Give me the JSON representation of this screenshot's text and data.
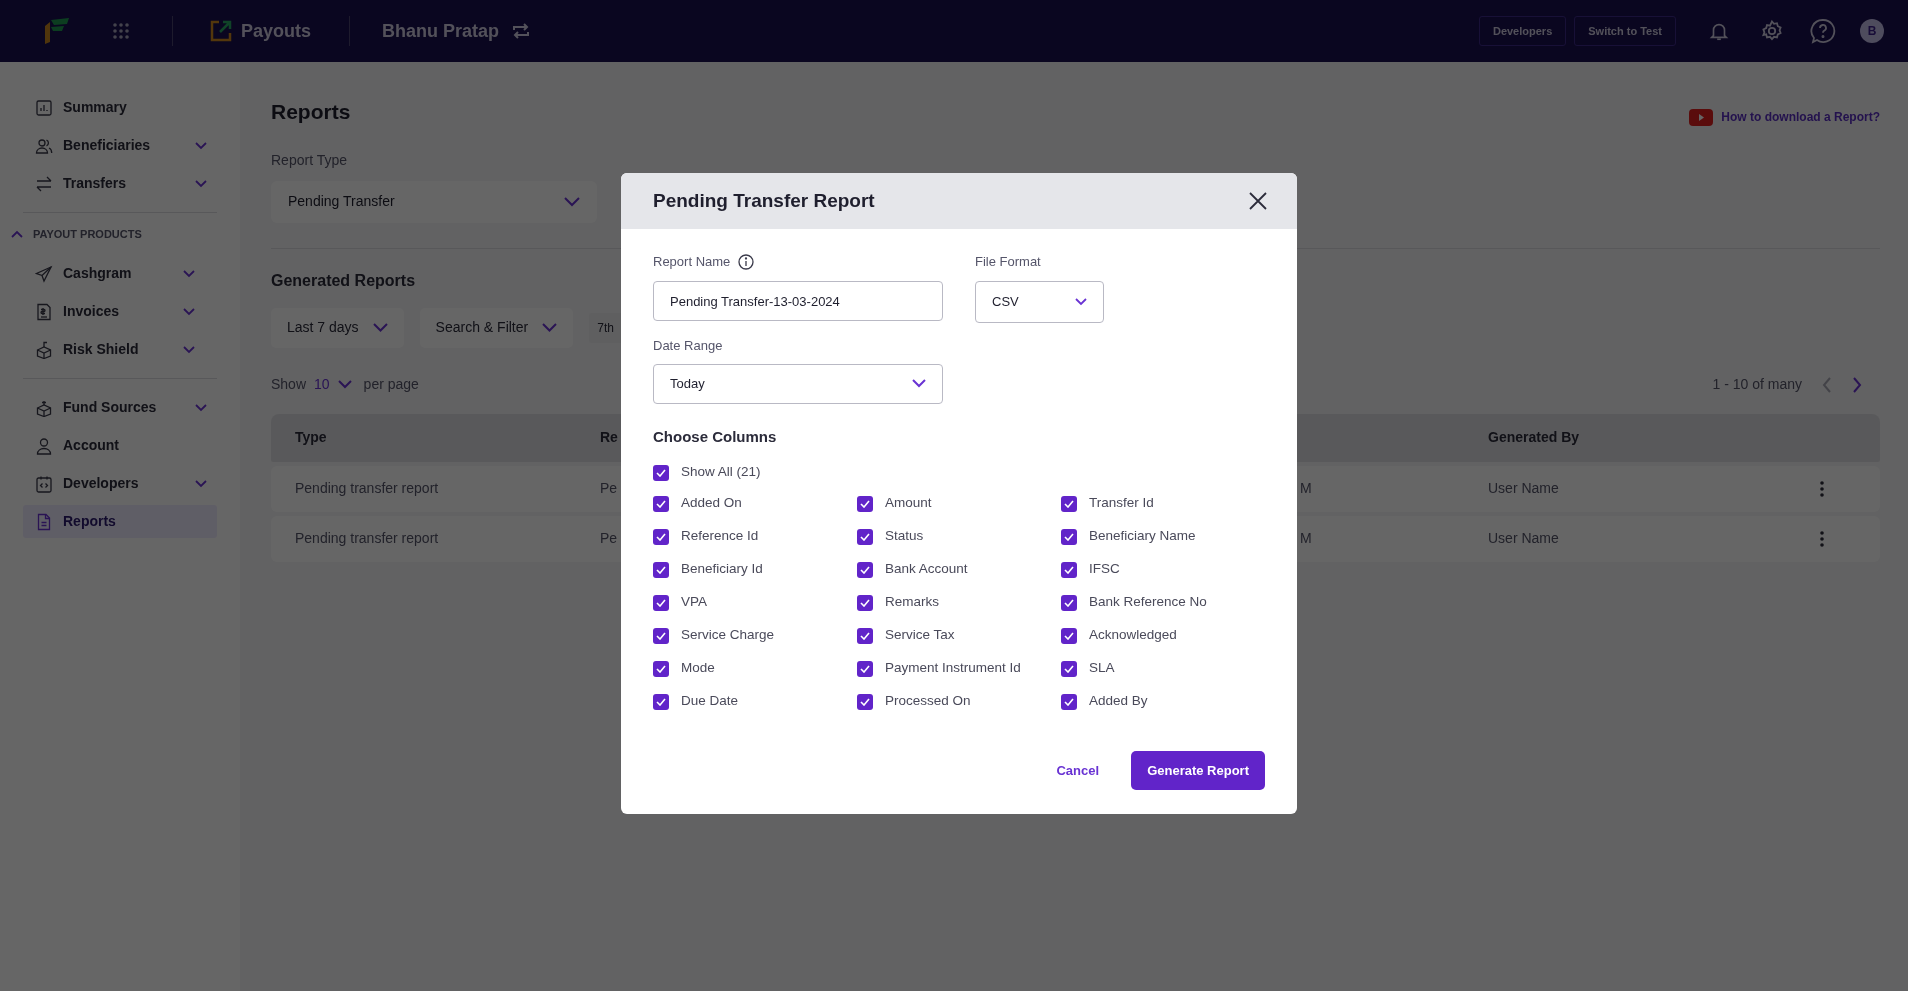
{
  "topbar": {
    "product": "Payouts",
    "account": "Bhanu Pratap",
    "buttons": [
      "Developers",
      "Switch to Test"
    ],
    "avatar": "B"
  },
  "sidebar": {
    "items": [
      {
        "kind": "link",
        "label": "Summary",
        "has_submenu": false,
        "selected": false
      },
      {
        "kind": "link",
        "label": "Beneficiaries",
        "has_submenu": true,
        "selected": false
      },
      {
        "kind": "link",
        "label": "Transfers",
        "has_submenu": true,
        "selected": false
      },
      {
        "kind": "divider"
      },
      {
        "kind": "section",
        "label": "PAYOUT PRODUCTS",
        "expanded": true,
        "children": [
          {
            "kind": "link",
            "label": "Cashgram",
            "has_submenu": true,
            "selected": false
          },
          {
            "kind": "link",
            "label": "Invoices",
            "has_submenu": true,
            "selected": false
          },
          {
            "kind": "link",
            "label": "Risk Shield",
            "has_submenu": true,
            "selected": false
          }
        ]
      },
      {
        "kind": "divider"
      },
      {
        "kind": "link",
        "label": "Fund Sources",
        "has_submenu": true,
        "selected": false
      },
      {
        "kind": "link",
        "label": "Account",
        "has_submenu": false,
        "selected": false
      },
      {
        "kind": "link",
        "label": "Developers",
        "has_submenu": true,
        "selected": false
      },
      {
        "kind": "link",
        "label": "Reports",
        "has_submenu": false,
        "selected": true
      }
    ]
  },
  "main": {
    "title": "Reports",
    "help_link": "How to download a Report?",
    "report_type": {
      "label": "Report Type",
      "value": "Pending Transfer"
    },
    "generated": {
      "title": "Generated Reports",
      "filters": [
        "Last 7 days",
        "Search & Filter"
      ],
      "date_chip": "7th",
      "page_size": {
        "prefix": "Show",
        "value": "10",
        "suffix": "per page"
      },
      "range": "1 - 10 of many",
      "prev_disabled": true,
      "next_disabled": false,
      "table": {
        "columns": [
          "Type",
          "Re",
          "",
          "Generated By"
        ],
        "rows": [
          {
            "cells": [
              "Pending transfer report",
              "Pe",
              "M",
              "User Name"
            ]
          },
          {
            "cells": [
              "Pending transfer report",
              "Pe",
              "M",
              "User Name"
            ]
          }
        ]
      }
    }
  },
  "modal": {
    "title": "Pending Transfer Report",
    "report_name": {
      "label": "Report Name",
      "value": "Pending Transfer-13-03-2024"
    },
    "file_format": {
      "label": "File Format",
      "value": "CSV"
    },
    "date_range": {
      "label": "Date Range",
      "value": "Today"
    },
    "columns_title": "Choose Columns",
    "show_all": {
      "label": "Show All (21)",
      "checked": true
    },
    "columns": [
      {
        "label": "Added On",
        "checked": true
      },
      {
        "label": "Amount",
        "checked": true
      },
      {
        "label": "Transfer Id",
        "checked": true
      },
      {
        "label": "Reference Id",
        "checked": true
      },
      {
        "label": "Status",
        "checked": true
      },
      {
        "label": "Beneficiary Name",
        "checked": true
      },
      {
        "label": "Beneficiary Id",
        "checked": true
      },
      {
        "label": "Bank Account",
        "checked": true
      },
      {
        "label": "IFSC",
        "checked": true
      },
      {
        "label": "VPA",
        "checked": true
      },
      {
        "label": "Remarks",
        "checked": true
      },
      {
        "label": "Bank Reference No",
        "checked": true
      },
      {
        "label": "Service Charge",
        "checked": true
      },
      {
        "label": "Service Tax",
        "checked": true
      },
      {
        "label": "Acknowledged",
        "checked": true
      },
      {
        "label": "Mode",
        "checked": true
      },
      {
        "label": "Payment Instrument Id",
        "checked": true
      },
      {
        "label": "SLA",
        "checked": true
      },
      {
        "label": "Due Date",
        "checked": true
      },
      {
        "label": "Processed On",
        "checked": true
      },
      {
        "label": "Added By",
        "checked": true
      }
    ],
    "cancel": "Cancel",
    "submit": "Generate Report"
  }
}
